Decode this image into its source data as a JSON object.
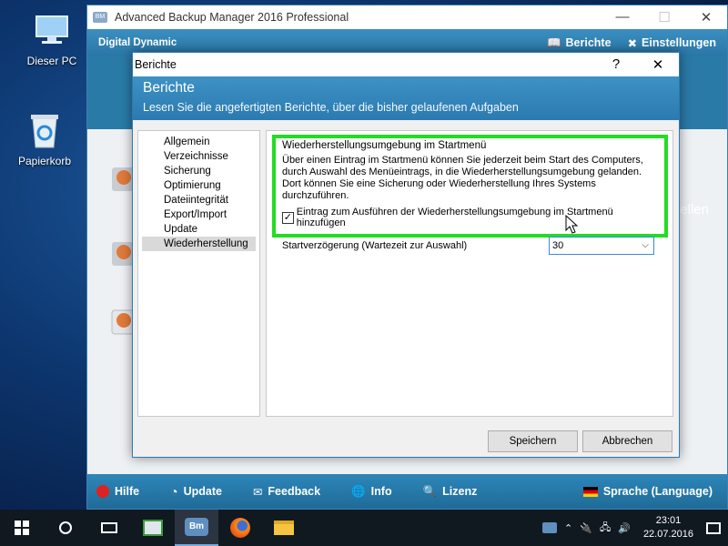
{
  "desktop": {
    "icons": [
      {
        "label": "Dieser PC"
      },
      {
        "label": "Papierkorb"
      }
    ]
  },
  "app": {
    "title": "Advanced Backup Manager 2016 Professional",
    "logo_abbr": "BM",
    "brand": "Digital Dynamic",
    "header_links": {
      "reports": "Berichte",
      "settings": "Einstellungen"
    },
    "side_text": "ellen",
    "footer": {
      "help": "Hilfe",
      "update": "Update",
      "feedback": "Feedback",
      "info": "Info",
      "license": "Lizenz",
      "language": "Sprache (Language)"
    }
  },
  "dialog": {
    "title": "Berichte",
    "help_glyph": "?",
    "close_glyph": "✕",
    "heading": "Berichte",
    "subheading": "Lesen Sie die angefertigten Berichte, über die bisher gelaufenen Aufgaben",
    "nav": [
      "Allgemein",
      "Verzeichnisse",
      "Sicherung",
      "Optimierung",
      "Dateiintegrität",
      "Export/Import",
      "Update",
      "Wiederherstellung"
    ],
    "nav_selected_index": 7,
    "section": {
      "title": "Wiederherstellungsumgebung im Startmenü",
      "description": "Über einen Eintrag im Startmenü können Sie jederzeit beim Start des Computers, durch Auswahl des Menüeintrags, in die Wiederherstellungsumgebung gelanden. Dort können Sie eine Sicherung oder Wiederherstellung Ihres Systems durchzuführen.",
      "checkbox_label": "Eintrag zum Ausführen der Wiederherstellungsumgebung im Startmenü hinzufügen",
      "checkbox_checked": true,
      "delay_label": "Startverzögerung (Wartezeit zur Auswahl)",
      "delay_value": "30"
    },
    "buttons": {
      "save": "Speichern",
      "cancel": "Abbrechen"
    }
  },
  "taskbar": {
    "taskview_app_abbr": "Bm",
    "clock_time": "23:01",
    "clock_date": "22.07.2016"
  },
  "colors": {
    "accent": "#2c7ab0",
    "highlight": "#22dd22",
    "taskbar": "#101820"
  }
}
